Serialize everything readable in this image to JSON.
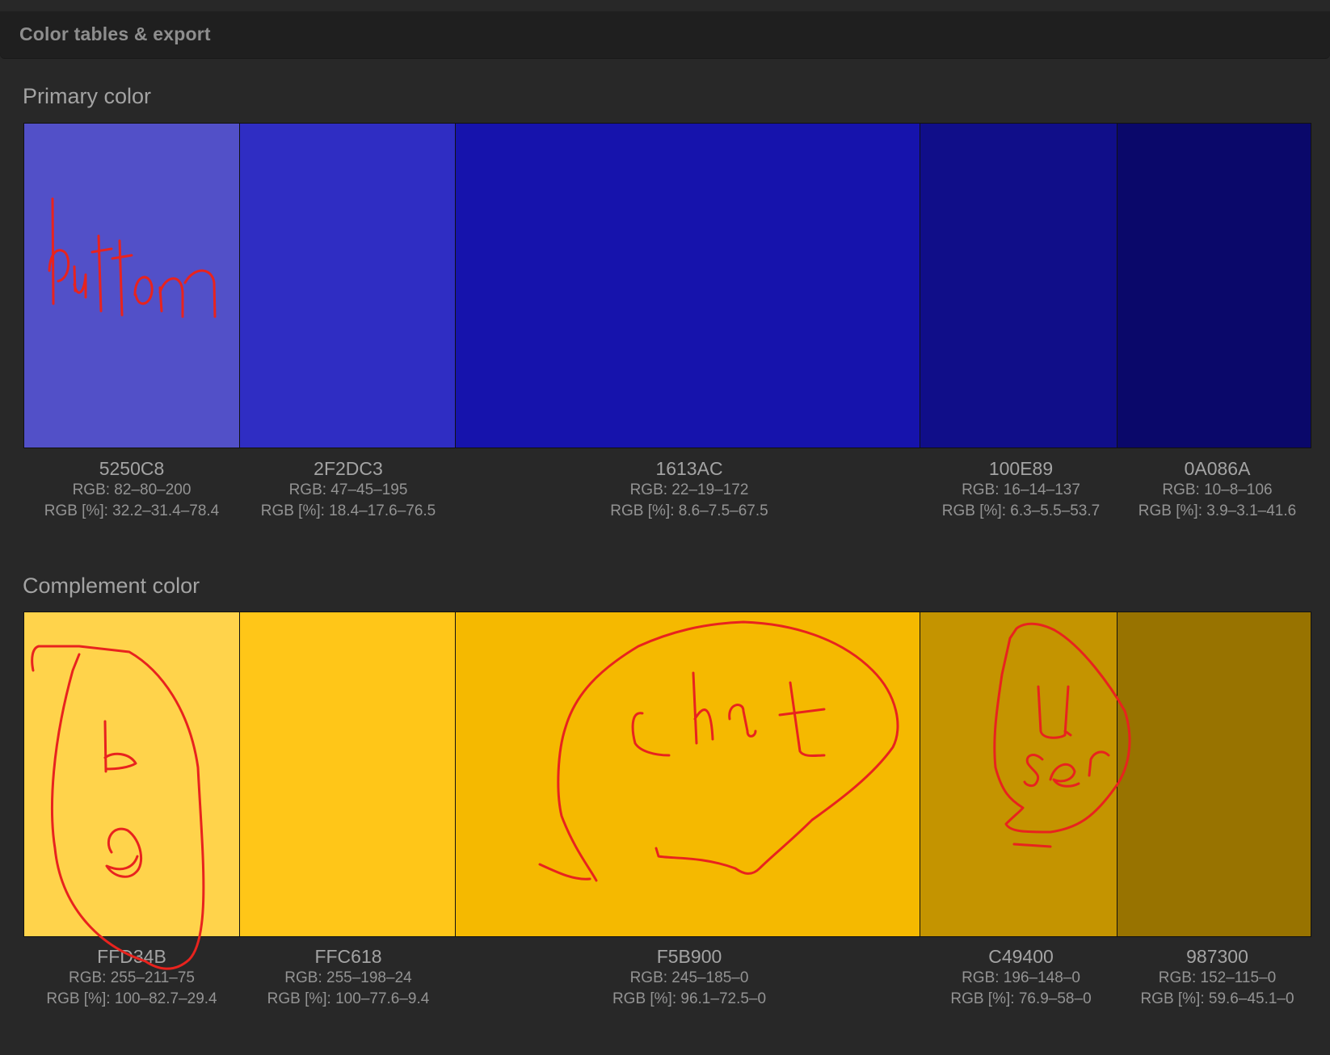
{
  "header": {
    "title": "Color tables & export"
  },
  "primary": {
    "title": "Primary color",
    "swatches": [
      {
        "color": "#5250C8",
        "hex": "5250C8",
        "rgb": "RGB: 82–80–200",
        "rgb_pct": "RGB [%]: 32.2–31.4–78.4"
      },
      {
        "color": "#2F2DC3",
        "hex": "2F2DC3",
        "rgb": "RGB: 47–45–195",
        "rgb_pct": "RGB [%]: 18.4–17.6–76.5"
      },
      {
        "color": "#1613AC",
        "hex": "1613AC",
        "rgb": "RGB: 22–19–172",
        "rgb_pct": "RGB [%]: 8.6–7.5–67.5"
      },
      {
        "color": "#100E89",
        "hex": "100E89",
        "rgb": "RGB: 16–14–137",
        "rgb_pct": "RGB [%]: 6.3–5.5–53.7"
      },
      {
        "color": "#0A086A",
        "hex": "0A086A",
        "rgb": "RGB: 10–8–106",
        "rgb_pct": "RGB [%]: 3.9–3.1–41.6"
      }
    ]
  },
  "complement": {
    "title": "Complement color",
    "swatches": [
      {
        "color": "#FFD34B",
        "hex": "FFD34B",
        "rgb": "RGB: 255–211–75",
        "rgb_pct": "RGB [%]: 100–82.7–29.4"
      },
      {
        "color": "#FFC618",
        "hex": "FFC618",
        "rgb": "RGB: 255–198–24",
        "rgb_pct": "RGB [%]: 100–77.6–9.4"
      },
      {
        "color": "#F5B900",
        "hex": "F5B900",
        "rgb": "RGB: 245–185–0",
        "rgb_pct": "RGB [%]: 96.1–72.5–0"
      },
      {
        "color": "#C49400",
        "hex": "C49400",
        "rgb": "RGB: 196–148–0",
        "rgb_pct": "RGB [%]: 76.9–58–0"
      },
      {
        "color": "#987300",
        "hex": "987300",
        "rgb": "RGB: 152–115–0",
        "rgb_pct": "RGB [%]: 59.6–45.1–0"
      }
    ]
  },
  "handwritten_annotations": {
    "stroke_color": "#E8231E",
    "words": [
      "button",
      "bo",
      "chat",
      "user"
    ]
  }
}
